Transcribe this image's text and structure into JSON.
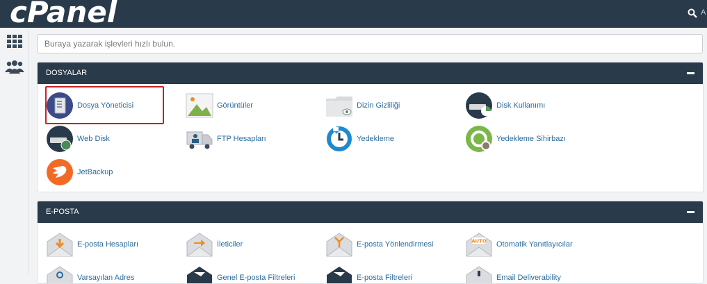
{
  "header": {
    "logo": "cPanel",
    "user_initial": "A"
  },
  "search": {
    "placeholder": "Buraya yazarak işlevleri hızlı bulun."
  },
  "sections": [
    {
      "title": "DOSYALAR",
      "items": [
        {
          "label": "Dosya Yöneticisi",
          "icon": "file-manager-icon"
        },
        {
          "label": "Görüntüler",
          "icon": "images-icon"
        },
        {
          "label": "Dizin Gizliliği",
          "icon": "directory-privacy-icon"
        },
        {
          "label": "Disk Kullanımı",
          "icon": "disk-usage-icon"
        },
        {
          "label": "Web Disk",
          "icon": "web-disk-icon"
        },
        {
          "label": "FTP Hesapları",
          "icon": "ftp-accounts-icon"
        },
        {
          "label": "Yedekleme",
          "icon": "backup-icon"
        },
        {
          "label": "Yedekleme Sihirbazı",
          "icon": "backup-wizard-icon"
        },
        {
          "label": "JetBackup",
          "icon": "jetbackup-icon"
        }
      ]
    },
    {
      "title": "E-POSTA",
      "items": [
        {
          "label": "E-posta Hesapları",
          "icon": "email-accounts-icon"
        },
        {
          "label": "İleticiler",
          "icon": "forwarders-icon"
        },
        {
          "label": "E-posta Yönlendirmesi",
          "icon": "email-routing-icon"
        },
        {
          "label": "Otomatik Yanıtlayıcılar",
          "icon": "autoresponders-icon"
        },
        {
          "label": "Varsayılan Adres",
          "icon": "default-address-icon"
        },
        {
          "label": "Genel E-posta Filtreleri",
          "icon": "global-email-filters-icon"
        },
        {
          "label": "E-posta Filtreleri",
          "icon": "email-filters-icon"
        },
        {
          "label": "Email Deliverability",
          "icon": "email-deliverability-icon"
        }
      ]
    }
  ],
  "colors": {
    "header": "#293a4a",
    "link": "#2a6c9d",
    "highlight": "#cf1f25"
  }
}
